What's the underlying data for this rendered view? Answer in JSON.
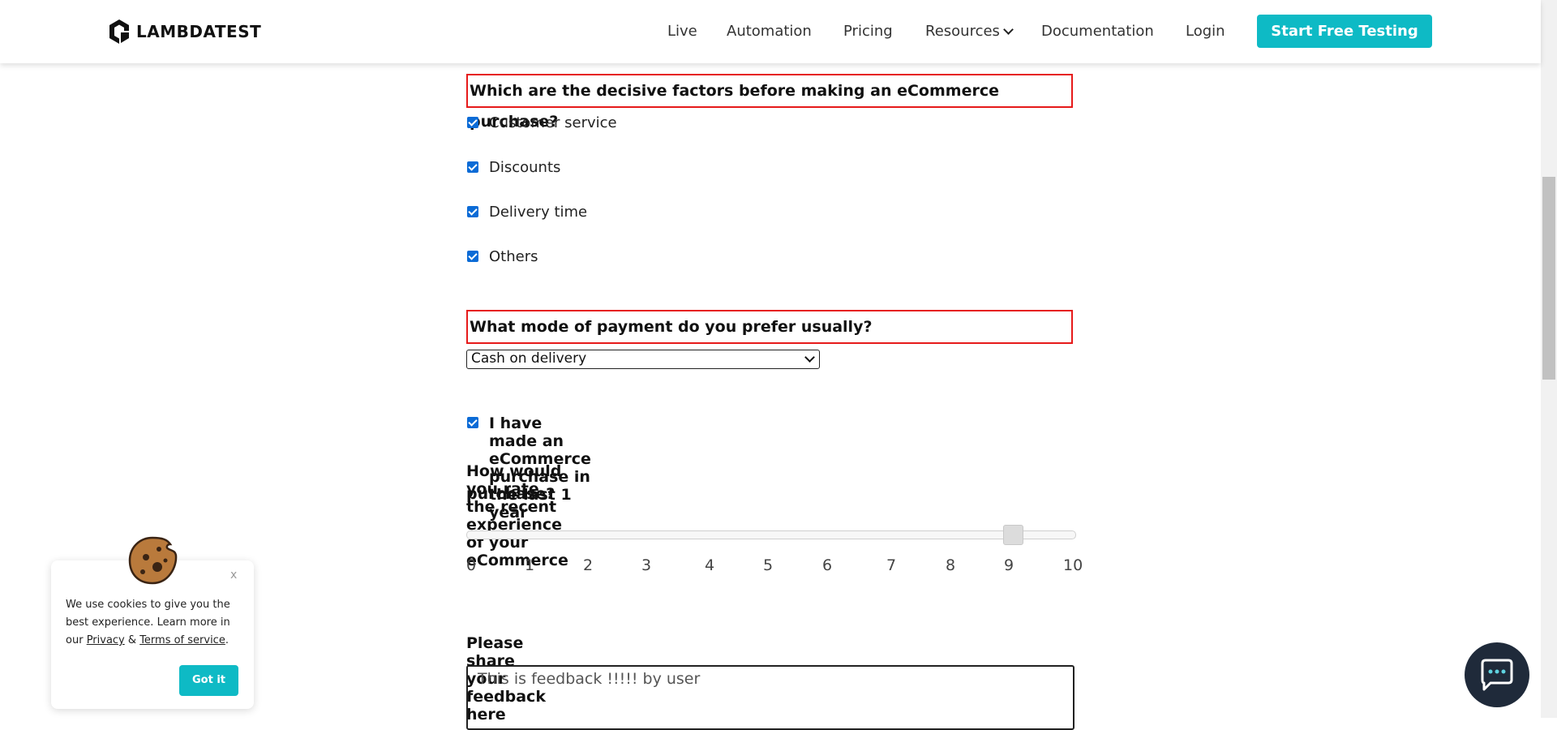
{
  "header": {
    "logo_text": "LAMBDATEST",
    "nav": [
      "Live",
      "Automation",
      "Pricing",
      "Resources",
      "Documentation",
      "Login"
    ],
    "cta": "Start Free Testing"
  },
  "form": {
    "q1": "Which are the decisive factors before making an eCommerce purchase?",
    "q1_options": [
      "Customer service",
      "Discounts",
      "Delivery time",
      "Others"
    ],
    "q2": "What mode of payment do you prefer usually?",
    "payment_selected": "Cash on delivery",
    "purchase_check": "I have made an eCommerce purchase in the last 1 year",
    "rating_q_line1": "How would you rate the recent experience of your eCommerce",
    "rating_q_line2": "purchase?",
    "rating_value": 9,
    "rating_ticks": [
      "0",
      "1",
      "2",
      "3",
      "4",
      "5",
      "6",
      "7",
      "8",
      "9",
      "10"
    ],
    "feedback_label": "Please share your feedback here",
    "feedback_value": "This is feedback !!!!! by user"
  },
  "cookie": {
    "close": "x",
    "text_pre": "We use cookies to give you the best experience. Learn more in our",
    "privacy": "Privacy",
    "amp": "&",
    "terms": "Terms of service",
    "dot": ".",
    "button": "Got it"
  },
  "colors": {
    "accent": "#0ebac5",
    "highlight_border": "#e61a1a",
    "checkbox": "#0b6bd6"
  }
}
